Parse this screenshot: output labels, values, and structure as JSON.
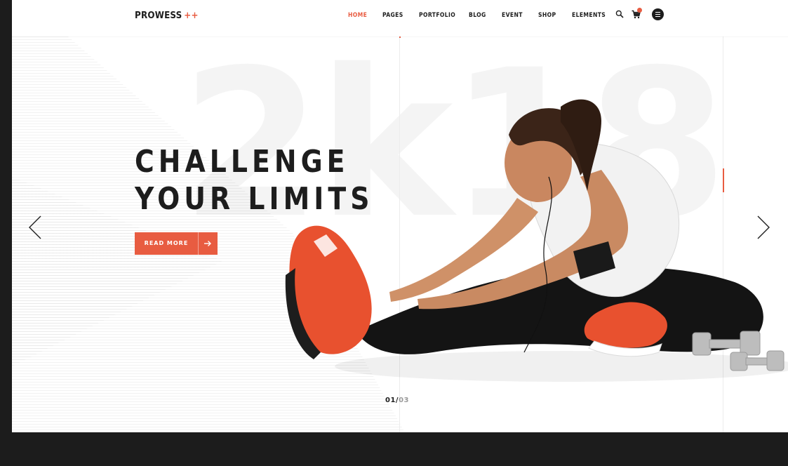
{
  "brand": {
    "name": "PROWESS",
    "mark": "++",
    "accent_color": "#e85c41"
  },
  "nav": {
    "items": [
      {
        "label": "HOME",
        "active": true
      },
      {
        "label": "PAGES",
        "active": false
      },
      {
        "label": "PORTFOLIO",
        "active": false
      },
      {
        "label": "BLOG",
        "active": false
      },
      {
        "label": "EVENT",
        "active": false
      },
      {
        "label": "SHOP",
        "active": false
      },
      {
        "label": "ELEMENTS",
        "active": false
      }
    ],
    "icons": [
      "search-icon",
      "cart-icon",
      "menu-icon"
    ]
  },
  "hero": {
    "background_text": "2k18",
    "headline_line1": "CHALLENGE",
    "headline_line2": "YOUR LIMITS",
    "cta_label": "READ MORE",
    "cta_icon": "arrow-right-icon",
    "image": "athlete-stretching-photo"
  },
  "slider": {
    "current": "01",
    "separator": "/",
    "total": "03"
  }
}
